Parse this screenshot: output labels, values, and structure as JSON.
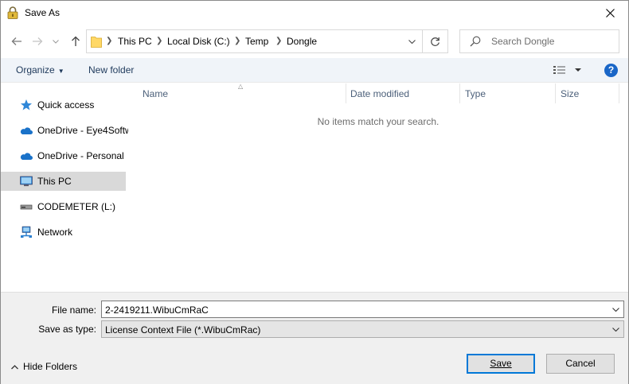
{
  "window": {
    "title": "Save As"
  },
  "address": {
    "crumbs": [
      "This PC",
      "Local Disk (C:)",
      "Temp",
      "Dongle"
    ]
  },
  "search": {
    "placeholder": "Search Dongle"
  },
  "toolbar": {
    "organize_label": "Organize",
    "new_folder_label": "New folder",
    "help_label": "?"
  },
  "nav_pane": {
    "items": [
      {
        "label": "Quick access",
        "icon": "star-icon"
      },
      {
        "label": "OneDrive - Eye4Softw",
        "icon": "cloud-icon"
      },
      {
        "label": "OneDrive - Personal",
        "icon": "cloud-icon"
      },
      {
        "label": "This PC",
        "icon": "computer-icon",
        "selected": true
      },
      {
        "label": "CODEMETER (L:)",
        "icon": "drive-icon"
      },
      {
        "label": "Network",
        "icon": "network-icon"
      }
    ]
  },
  "file_list": {
    "columns": [
      "Name",
      "Date modified",
      "Type",
      "Size"
    ],
    "empty_message": "No items match your search."
  },
  "form": {
    "file_name_label": "File name:",
    "file_name_value": "2-2419211.WibuCmRaC",
    "save_type_label": "Save as type:",
    "save_type_value": "License Context File (*.WibuCmRac)"
  },
  "footer": {
    "hide_folders_label": "Hide Folders",
    "save_label": "Save",
    "cancel_label": "Cancel"
  },
  "colors": {
    "accent": "#0078d7",
    "toolbar_bg": "#f0f4f9",
    "selected_bg": "#d9d9d9",
    "link_text": "#1e395b"
  }
}
